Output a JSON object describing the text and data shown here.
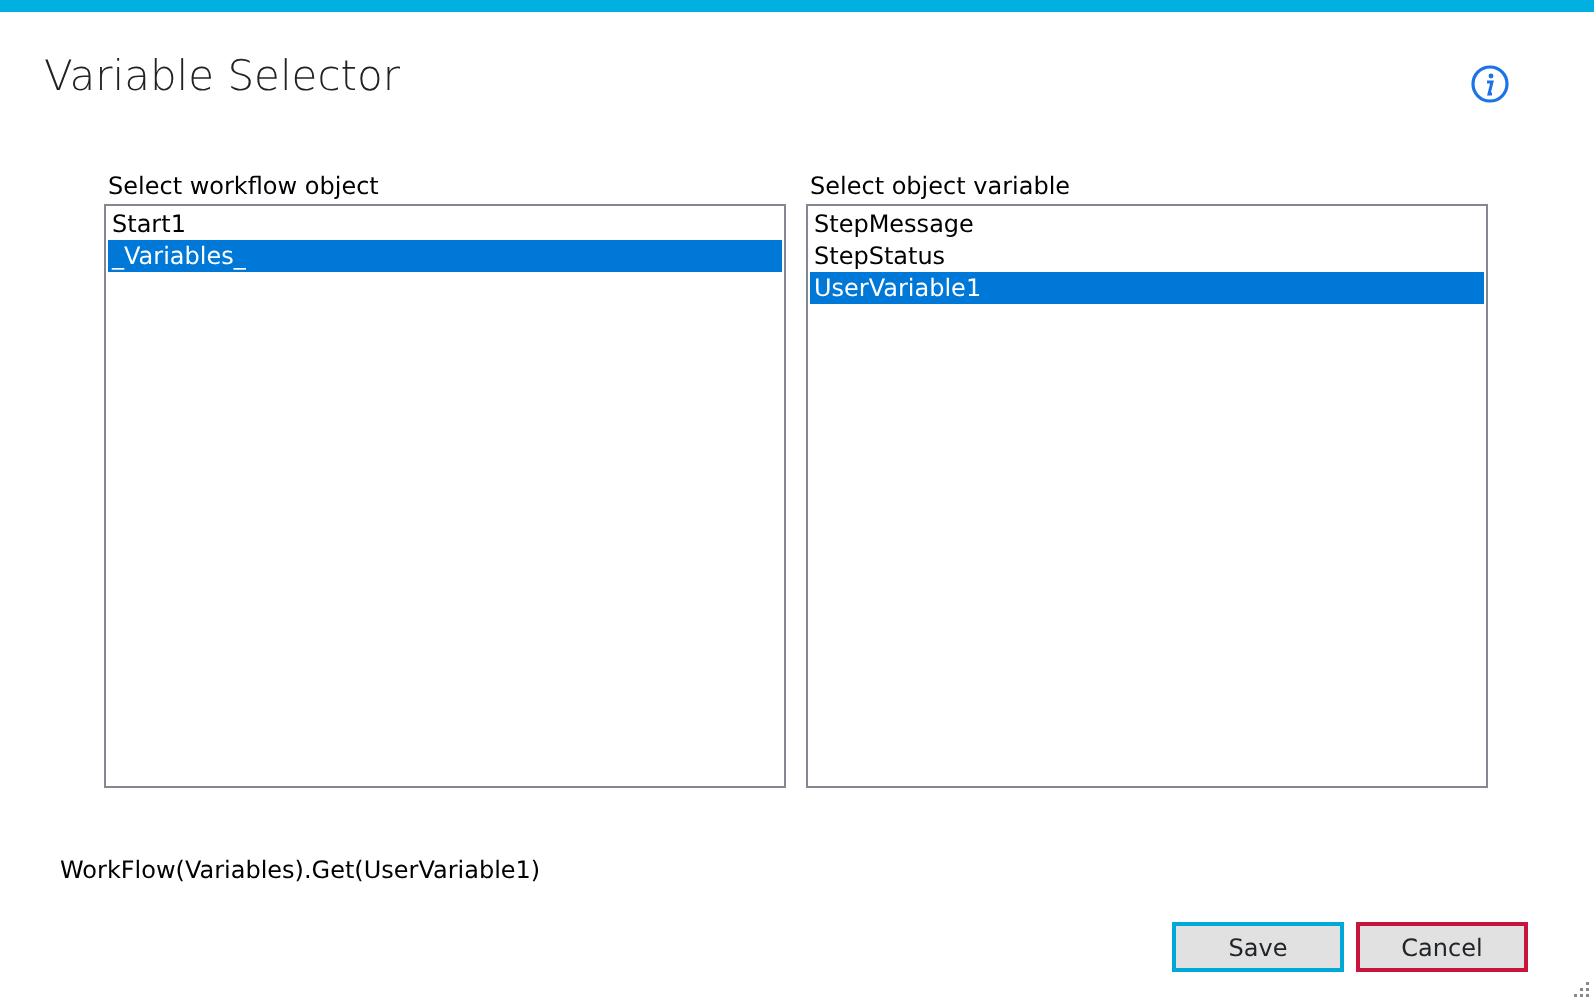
{
  "window": {
    "title": "Variable Selector"
  },
  "lists": [
    {
      "label": "Select workflow object",
      "items": [
        {
          "text": "Start1",
          "selected": false
        },
        {
          "text": "_Variables_",
          "selected": true
        }
      ]
    },
    {
      "label": "Select object variable",
      "items": [
        {
          "text": "StepMessage",
          "selected": false
        },
        {
          "text": "StepStatus",
          "selected": false
        },
        {
          "text": "UserVariable1",
          "selected": true
        }
      ]
    }
  ],
  "expression": "WorkFlow(Variables).Get(UserVariable1)",
  "buttons": [
    {
      "label": "Save",
      "kind": "save"
    },
    {
      "label": "Cancel",
      "kind": "cancel"
    }
  ]
}
